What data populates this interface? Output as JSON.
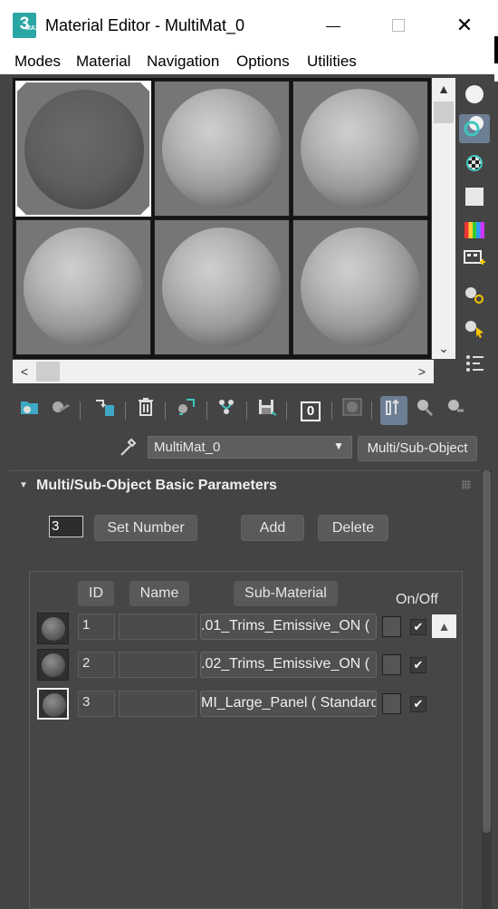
{
  "window": {
    "title": "Material Editor - MultiMat_0",
    "app_icon_text": "3",
    "app_icon_sub": "MAX",
    "minimize_glyph": "",
    "maximize_glyph": "",
    "close_glyph": "✕"
  },
  "menu": [
    "Modes",
    "Material",
    "Navigation",
    "Options",
    "Utilities"
  ],
  "slots": {
    "scroll_up": "▲",
    "scroll_down": "⌄",
    "scroll_left": "<",
    "scroll_right": ">"
  },
  "side_toolbar_icons": [
    "sample-type-sphere-icon",
    "backlight-icon",
    "background-checker-icon",
    "sample-uv-tiling-icon",
    "video-color-check-icon",
    "make-preview-icon",
    "options-icon",
    "select-by-material-icon",
    "material-map-navigator-icon"
  ],
  "toolbar_icons": [
    "get-material-icon",
    "put-material-to-scene-icon",
    "assign-material-to-selection-icon",
    "reset-map-icon",
    "make-material-copy-icon",
    "make-unique-icon",
    "put-to-library-icon",
    "material-id-channel-icon",
    "show-shaded-material-icon",
    "show-end-result-icon",
    "go-to-parent-icon",
    "go-forward-to-sibling-icon"
  ],
  "toolbar": {
    "material_id_value": "0"
  },
  "material": {
    "name": "MultiMat_0",
    "dropdown_arrow": "▼",
    "type": "Multi/Sub-Object"
  },
  "rollout": {
    "arrow": "▼",
    "title": "Multi/Sub-Object Basic Parameters",
    "count": "3",
    "set_number": "Set Number",
    "add": "Add",
    "delete": "Delete"
  },
  "table": {
    "headers": {
      "id": "ID",
      "name": "Name",
      "sub_material": "Sub-Material",
      "on_off": "On/Off"
    },
    "rows": [
      {
        "id": "1",
        "name": "",
        "sub_material": ".01_Trims_Emissive_ON  (",
        "enabled": "✔"
      },
      {
        "id": "2",
        "name": "",
        "sub_material": ".02_Trims_Emissive_ON  (",
        "enabled": "✔"
      },
      {
        "id": "3",
        "name": "",
        "sub_material": "MI_Large_Panel  ( Standard",
        "enabled": "✔"
      }
    ],
    "scroll_up": "▲"
  },
  "colors": {
    "background": "#444444",
    "accent_active": "#6d7f95",
    "titlebar": "#ffffff"
  }
}
